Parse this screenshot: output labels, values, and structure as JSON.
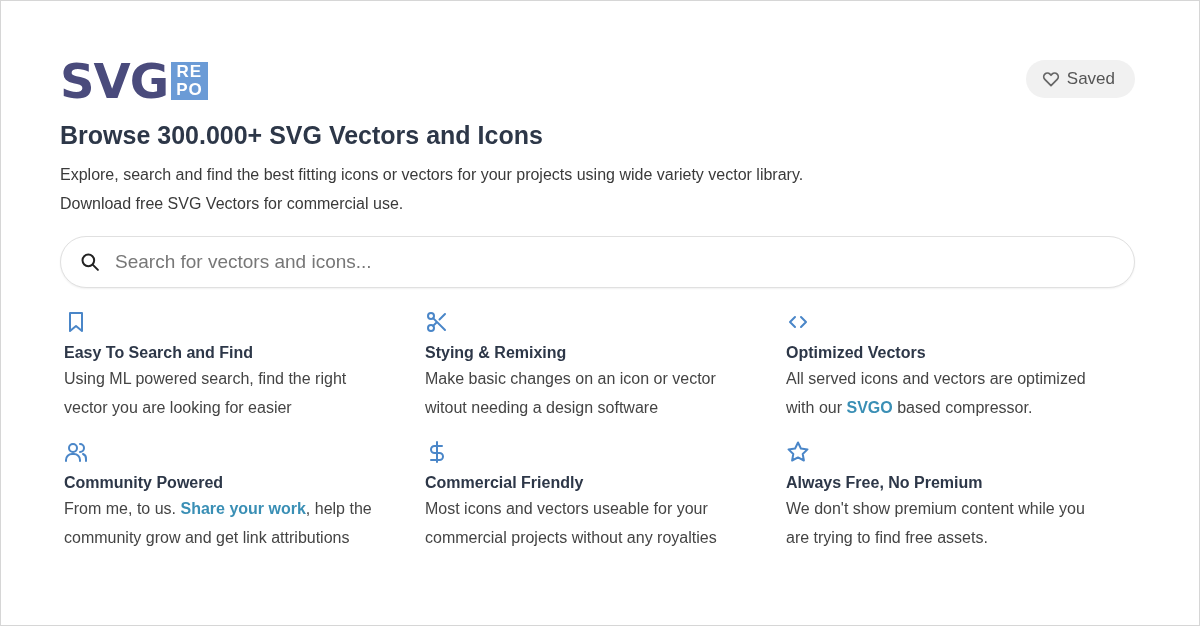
{
  "logo": {
    "main": "SVG",
    "badge_top": "RE",
    "badge_bottom": "PO"
  },
  "saved_button": {
    "label": "Saved"
  },
  "heading": "Browse 300.000+ SVG Vectors and Icons",
  "intro": [
    "Explore, search and find the best fitting icons or vectors for your projects using wide variety vector library.",
    "Download free SVG Vectors for commercial use."
  ],
  "search": {
    "placeholder": "Search for vectors and icons..."
  },
  "features": [
    {
      "title": "Easy To Search and Find",
      "description": [
        {
          "text": "Using ML powered search, find the right vector you are looking for easier"
        }
      ]
    },
    {
      "title": "Stying & Remixing",
      "description": [
        {
          "text": "Make basic changes on an icon or vector witout needing a design software"
        }
      ]
    },
    {
      "title": "Optimized Vectors",
      "description": [
        {
          "text": "All served icons and vectors are optimized with our "
        },
        {
          "text": "SVGO",
          "kind": "link"
        },
        {
          "text": " based compressor."
        }
      ]
    },
    {
      "title": "Community Powered",
      "description": [
        {
          "text": "From me, to us. "
        },
        {
          "text": "Share your work",
          "kind": "link"
        },
        {
          "text": ", help the community grow and get link attributions"
        }
      ]
    },
    {
      "title": "Commercial Friendly",
      "description": [
        {
          "text": "Most icons and vectors useable for your commercial projects without any royalties"
        }
      ]
    },
    {
      "title": "Always Free, No Premium",
      "description": [
        {
          "text": "We don't show premium content while you are trying to find free assets."
        }
      ]
    }
  ]
}
